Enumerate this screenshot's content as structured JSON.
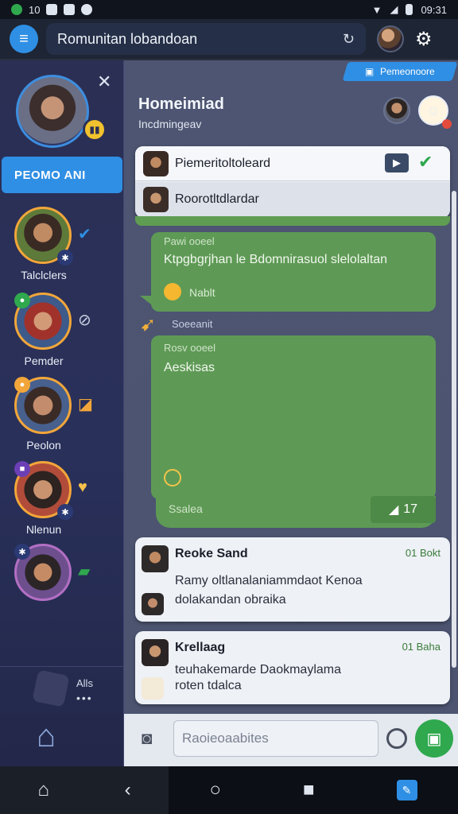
{
  "status_bar": {
    "left_text": "10",
    "time": "09:31"
  },
  "app_bar": {
    "title": "Romunitan lobandoan",
    "menu_icon": "hamburger-icon",
    "edit_icon": "edit-icon",
    "settings_icon": "gear-icon"
  },
  "sidebar": {
    "active_tab": "PEOMO ANI",
    "items": [
      {
        "name": "Talclclers",
        "status_icon": "check-icon",
        "status_color": "#2f8fe4"
      },
      {
        "name": "Pemder",
        "status_icon": "mute-icon",
        "status_color": "#c9d0e0"
      },
      {
        "name": "Peolon",
        "status_icon": "flag-icon",
        "status_color": "#f2a63a"
      },
      {
        "name": "Nlenun",
        "status_icon": "heart-icon",
        "status_color": "#f5c04a"
      },
      {
        "name": "",
        "status_icon": "check-badge-icon",
        "status_color": "#2fa84e"
      }
    ],
    "extra": {
      "label": "Alls",
      "dots": "•••"
    }
  },
  "main": {
    "pill_label": "Pemeonoore",
    "title": "Homeimiad",
    "subtitle": "Incdmingeav",
    "dropdown": [
      {
        "label": "Piemeritoltoleard"
      },
      {
        "label": "Roorotltdlardar"
      }
    ],
    "messages": [
      {
        "meta": "Pawi ooeel",
        "text": "Ktpgbgrjhan le Bdomnirasuol slelolaltan",
        "sub": "Nablt"
      },
      {
        "separator": "Soeeanit"
      },
      {
        "meta": "Rosv ooeel",
        "text": "Aeskisas",
        "foot_label": "Ssalea",
        "foot_count": "17"
      }
    ],
    "cards": [
      {
        "name": "Reoke Sand",
        "time": "01 Bokt",
        "line1": "Ramy oltlanalaniammdaot  Kenoa",
        "line2": "dolakandan obraika"
      },
      {
        "name": "Krellaag",
        "time": "01 Baha",
        "line1": "teuhakemarde Daokmaylama",
        "line2": "roten tdalca"
      }
    ],
    "composer": {
      "placeholder": "Raoieoaabites"
    }
  }
}
